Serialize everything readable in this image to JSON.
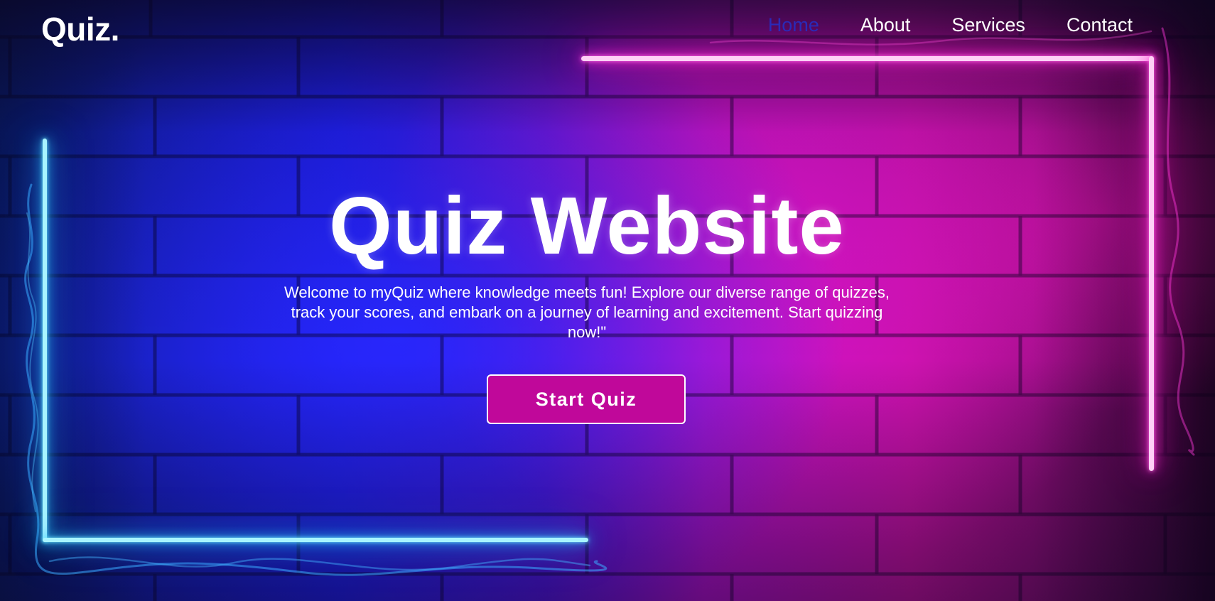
{
  "header": {
    "logo": "Quiz.",
    "nav": [
      {
        "label": "Home",
        "active": true
      },
      {
        "label": "About",
        "active": false
      },
      {
        "label": "Services",
        "active": false
      },
      {
        "label": "Contact",
        "active": false
      }
    ]
  },
  "hero": {
    "title": "Quiz Website",
    "description": "Welcome to myQuiz where knowledge meets fun! Explore our diverse range of quizzes, track your scores, and embark on a journey of learning and excitement. Start quizzing now!\"",
    "cta_label": "Start Quiz"
  },
  "colors": {
    "active_nav": "#2a2ab8",
    "button_bg": "#c0089a",
    "neon_blue": "#2ec8ff",
    "neon_pink": "#ff2ad6"
  }
}
